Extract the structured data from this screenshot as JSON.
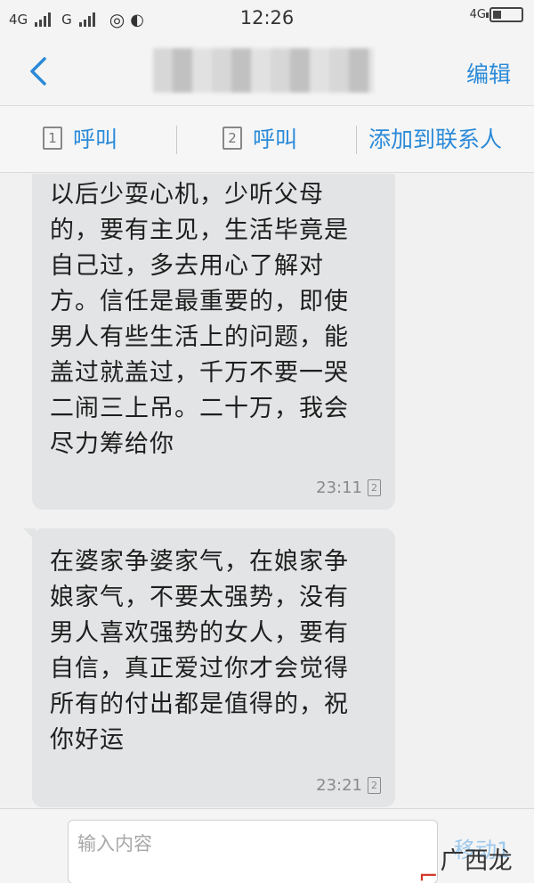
{
  "status_bar": {
    "net1": "4G",
    "net2": "G",
    "time": "12:26",
    "net_right": "4G"
  },
  "nav": {
    "edit_label": "编辑"
  },
  "actions": {
    "call1_label": "呼叫",
    "call1_sim": "1",
    "call2_label": "呼叫",
    "call2_sim": "2",
    "add_contact_label": "添加到联系人"
  },
  "messages": [
    {
      "text": "以后少耍心机，少听父母\n的，要有主见，生活毕竟是\n自己过，多去用心了解对\n方。信任是最重要的，即使\n男人有些生活上的问题，能\n盖过就盖过，千万不要一哭\n二闹三上吊。二十万，我会\n尽力筹给你",
      "time": "23:11",
      "sim": "2"
    },
    {
      "text": "在婆家争婆家气，在娘家争\n娘家气，不要太强势，没有\n男人喜欢强势的女人，要有\n自信，真正爱过你才会觉得\n所有的付出都是值得的，祝\n你好运",
      "time": "23:21",
      "sim": "2"
    }
  ],
  "composer": {
    "placeholder": "输入内容",
    "send_label": "移动1"
  },
  "watermark": {
    "text": "广西龙网"
  }
}
